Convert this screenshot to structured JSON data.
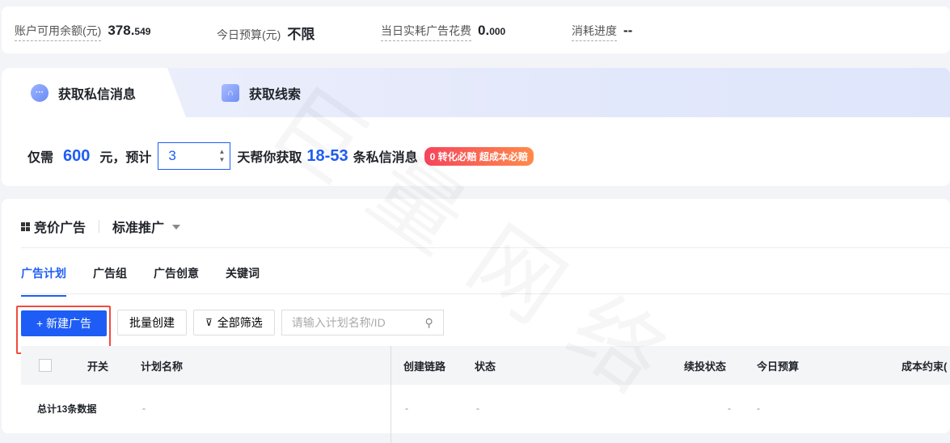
{
  "stats": [
    {
      "label": "账户可用余额(元)",
      "int": "378.",
      "dec": "549"
    },
    {
      "label": "今日预算(元)",
      "int": "不限",
      "dec": ""
    },
    {
      "label": "当日实耗广告花费",
      "int": "0.",
      "dec": "000"
    },
    {
      "label": "消耗进度",
      "int": "--",
      "dec": ""
    }
  ],
  "promo": {
    "tabs": [
      {
        "label": "获取私信消息",
        "icon": "chat-bubble-icon"
      },
      {
        "label": "获取线索",
        "icon": "folder-icon"
      }
    ],
    "prefix": "仅需",
    "amount": "600",
    "mid": "元，预计",
    "days": "3",
    "mid2": "天帮你获取",
    "range": "18-53",
    "suffix": "条私信消息",
    "badge": "0 转化必赔 超成本必赔"
  },
  "ads": {
    "title": "竞价广告",
    "mode": "标准推广",
    "tabs": [
      "广告计划",
      "广告组",
      "广告创意",
      "关键词"
    ],
    "new_button": "+ 新建广告",
    "batch_button": "批量创建",
    "filter_button": "全部筛选",
    "search_placeholder": "请输入计划名称/ID",
    "columns": [
      "开关",
      "计划名称",
      "创建链路",
      "状态",
      "续投状态",
      "今日预算",
      "成本约束("
    ],
    "total_row": {
      "label": "总计13条数据",
      "values": [
        "-",
        "-",
        "-",
        "-",
        "-"
      ]
    }
  },
  "watermark": "巨量网络",
  "colors": {
    "accent": "#1e5df5",
    "highlight": "#f04b3f"
  }
}
